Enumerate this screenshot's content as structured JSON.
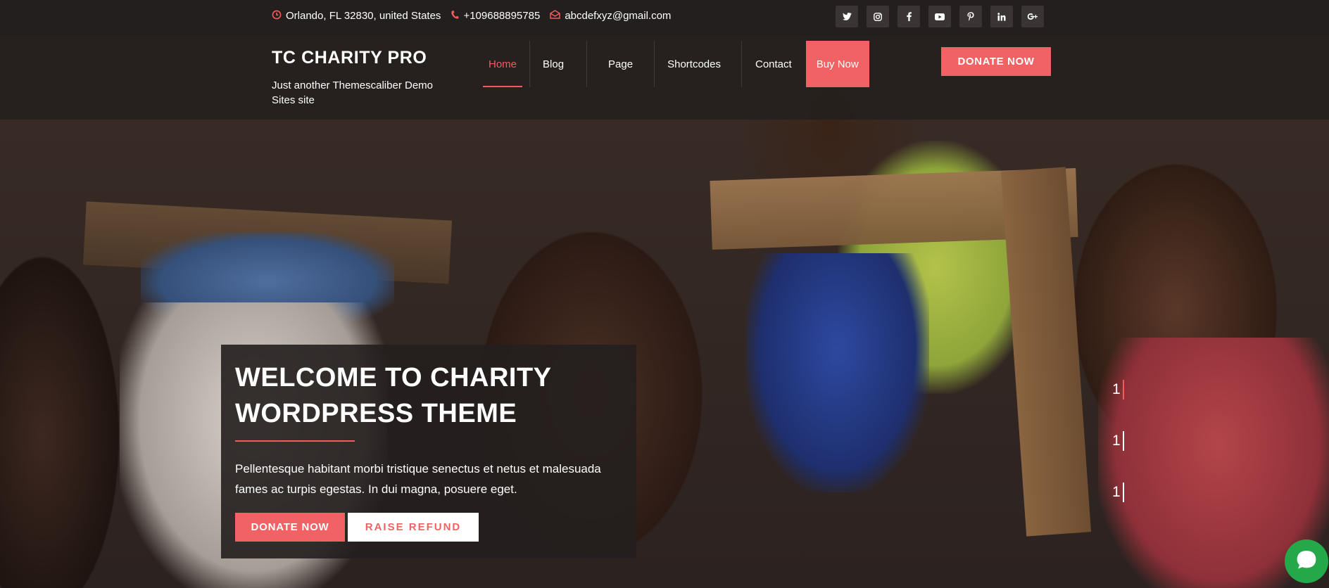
{
  "topbar": {
    "address": "Orlando, FL 32830, united States",
    "phone": "+109688895785",
    "email": "abcdefxyz@gmail.com",
    "social": [
      {
        "icon": "twitter-icon",
        "glyph": "𝕥"
      },
      {
        "icon": "instagram-icon",
        "glyph": "◎"
      },
      {
        "icon": "facebook-icon",
        "glyph": "f"
      },
      {
        "icon": "youtube-icon",
        "glyph": "▶"
      },
      {
        "icon": "pinterest-icon",
        "glyph": "p"
      },
      {
        "icon": "linkedin-icon",
        "glyph": "in"
      },
      {
        "icon": "google-plus-icon",
        "glyph": "G+"
      }
    ]
  },
  "brand": {
    "title": "TC CHARITY PRO",
    "tagline": "Just another Themescaliber Demo Sites site"
  },
  "nav": {
    "items": [
      "Home",
      "Blog",
      "Page",
      "Shortcodes",
      "Contact"
    ],
    "buy": "Buy Now",
    "donate": "DONATE NOW"
  },
  "hero": {
    "heading": "WELCOME TO CHARITY WORDPRESS THEME",
    "text": "Pellentesque habitant morbi tristique senectus et netus et malesuada fames ac turpis egestas. In dui magna, posuere eget.",
    "donate_button": "DONATE NOW",
    "refund_button": "RAISE REFUND"
  },
  "slider": {
    "indicators": [
      "1",
      "1",
      "1"
    ],
    "active_index": 0
  },
  "colors": {
    "accent": "#f06264",
    "topbar_bg": "#231f1e",
    "chat_green": "#23a94a"
  }
}
